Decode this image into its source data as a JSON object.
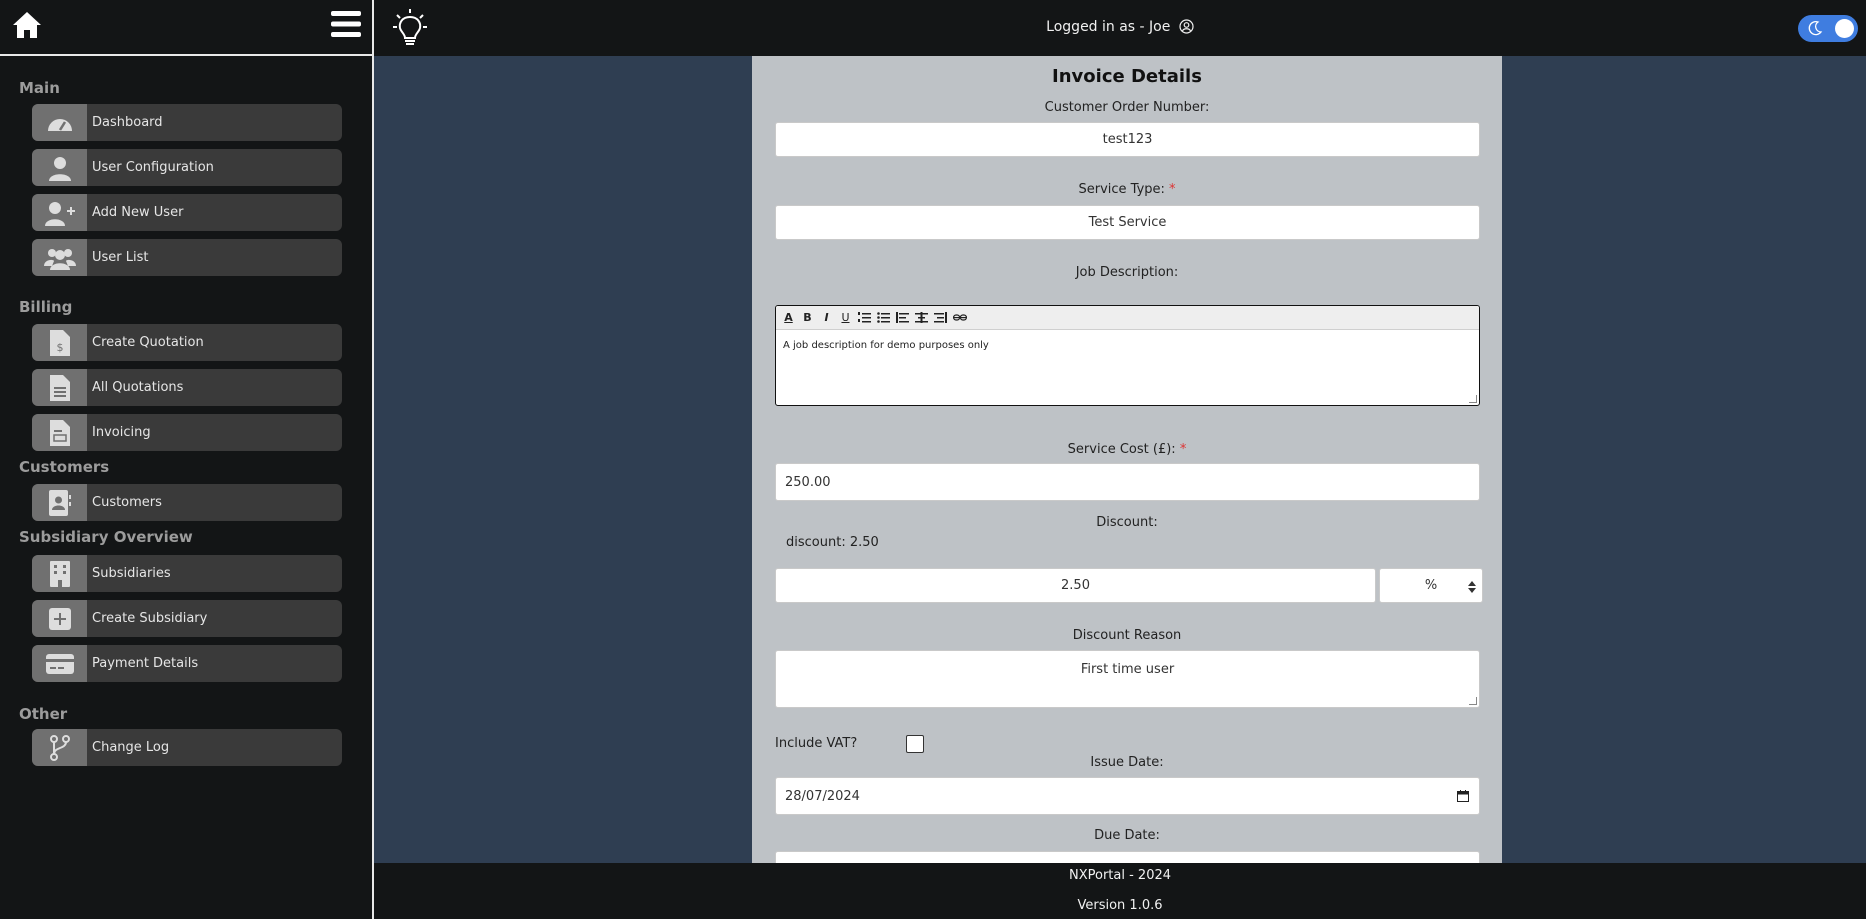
{
  "sidebar": {
    "sections": {
      "main": "Main",
      "billing": "Billing",
      "customers": "Customers",
      "subsidiary": "Subsidiary Overview",
      "other": "Other"
    },
    "items": {
      "dashboard": "Dashboard",
      "user_configuration": "User Configuration",
      "add_new_user": "Add New User",
      "user_list": "User List",
      "create_quotation": "Create Quotation",
      "all_quotations": "All Quotations",
      "invoicing": "Invoicing",
      "customers": "Customers",
      "subsidiaries": "Subsidiaries",
      "create_subsidiary": "Create Subsidiary",
      "payment_details": "Payment Details",
      "change_log": "Change Log"
    }
  },
  "header": {
    "logged_in_text": "Logged in as - Joe"
  },
  "form": {
    "title": "Invoice Details",
    "customer_order_label": "Customer Order Number:",
    "customer_order_value": "test123",
    "service_type_label": "Service Type:",
    "service_type_value": "Test Service",
    "job_description_label": "Job Description:",
    "job_description_value": "A job description for demo purposes only",
    "service_cost_label": "Service Cost (£):",
    "service_cost_value": "250.00",
    "discount_label": "Discount:",
    "discount_inline": "discount: 2.50",
    "discount_value": "2.50",
    "discount_unit": "%",
    "discount_reason_label": "Discount Reason",
    "discount_reason_value": "First time user",
    "vat_label": "Include VAT?",
    "vat_checked": false,
    "issue_date_label": "Issue Date:",
    "issue_date_value": "28/07/2024",
    "due_date_label": "Due Date:",
    "required_mark": "*"
  },
  "footer": {
    "line1": "NXPortal - 2024",
    "line2": "Version 1.0.6"
  },
  "colors": {
    "sidebar_bg": "#131516",
    "page_bg": "#2f3e52",
    "panel_bg": "#bec2c6",
    "toggle": "#3f7de0"
  }
}
